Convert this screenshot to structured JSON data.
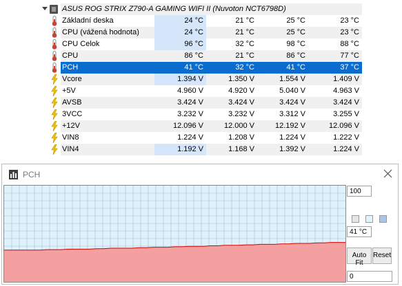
{
  "device": {
    "name": "ASUS ROG STRIX Z790-A GAMING WIFI II (Nuvoton NCT6798D)"
  },
  "sensors": [
    {
      "label": "Základní deska",
      "icon": "thermometer-icon",
      "current": "24 °C",
      "min": "21 °C",
      "max": "25 °C",
      "avg": "23 °C",
      "highlight": true,
      "selected": false
    },
    {
      "label": "CPU (vážená hodnota)",
      "icon": "thermometer-icon",
      "current": "24 °C",
      "min": "21 °C",
      "max": "25 °C",
      "avg": "23 °C",
      "highlight": true,
      "selected": false
    },
    {
      "label": "CPU Celok",
      "icon": "thermometer-icon",
      "current": "96 °C",
      "min": "32 °C",
      "max": "98 °C",
      "avg": "88 °C",
      "highlight": true,
      "selected": false
    },
    {
      "label": "CPU",
      "icon": "thermometer-icon",
      "current": "86 °C",
      "min": "21 °C",
      "max": "86 °C",
      "avg": "77 °C",
      "highlight": false,
      "selected": false
    },
    {
      "label": "PCH",
      "icon": "thermometer-icon",
      "current": "41 °C",
      "min": "32 °C",
      "max": "41 °C",
      "avg": "37 °C",
      "highlight": false,
      "selected": true
    },
    {
      "label": "Vcore",
      "icon": "lightning-icon",
      "current": "1.394 V",
      "min": "1.350 V",
      "max": "1.554 V",
      "avg": "1.409 V",
      "highlight": true,
      "selected": false
    },
    {
      "label": "+5V",
      "icon": "lightning-icon",
      "current": "4.960 V",
      "min": "4.920 V",
      "max": "5.040 V",
      "avg": "4.963 V",
      "highlight": false,
      "selected": false
    },
    {
      "label": "AVSB",
      "icon": "lightning-icon",
      "current": "3.424 V",
      "min": "3.424 V",
      "max": "3.424 V",
      "avg": "3.424 V",
      "highlight": false,
      "selected": false
    },
    {
      "label": "3VCC",
      "icon": "lightning-icon",
      "current": "3.232 V",
      "min": "3.232 V",
      "max": "3.312 V",
      "avg": "3.255 V",
      "highlight": false,
      "selected": false
    },
    {
      "label": "+12V",
      "icon": "lightning-icon",
      "current": "12.096 V",
      "min": "12.000 V",
      "max": "12.192 V",
      "avg": "12.096 V",
      "highlight": false,
      "selected": false
    },
    {
      "label": "VIN8",
      "icon": "lightning-icon",
      "current": "1.224 V",
      "min": "1.208 V",
      "max": "1.224 V",
      "avg": "1.222 V",
      "highlight": false,
      "selected": false
    },
    {
      "label": "VIN4",
      "icon": "lightning-icon",
      "current": "1.192 V",
      "min": "1.168 V",
      "max": "1.392 V",
      "avg": "1.224 V",
      "highlight": true,
      "selected": false
    }
  ],
  "graph_window": {
    "title": "PCH",
    "max_value": "100",
    "current_value": "41 °C",
    "min_value": "0",
    "auto_fit_label": "Auto Fit",
    "reset_label": "Reset",
    "series_color": "#f4a0a0",
    "line_color": "#d40000",
    "grid_color": "#9fc2da",
    "background_color": "#dff1fb",
    "history_values": [
      33,
      33,
      33,
      33,
      33,
      33,
      33.5,
      33.5,
      33.5,
      34,
      34,
      34,
      34,
      34.5,
      34.5,
      35,
      35,
      35,
      35,
      35.5,
      35.5,
      36,
      36,
      36,
      36.5,
      36.5,
      37,
      37,
      37,
      37.5,
      37.5,
      38,
      38,
      38,
      38.5,
      38.5,
      39,
      39,
      39,
      39.5,
      39.5,
      40,
      40,
      40,
      40.5,
      40.5,
      41,
      41,
      41
    ]
  }
}
